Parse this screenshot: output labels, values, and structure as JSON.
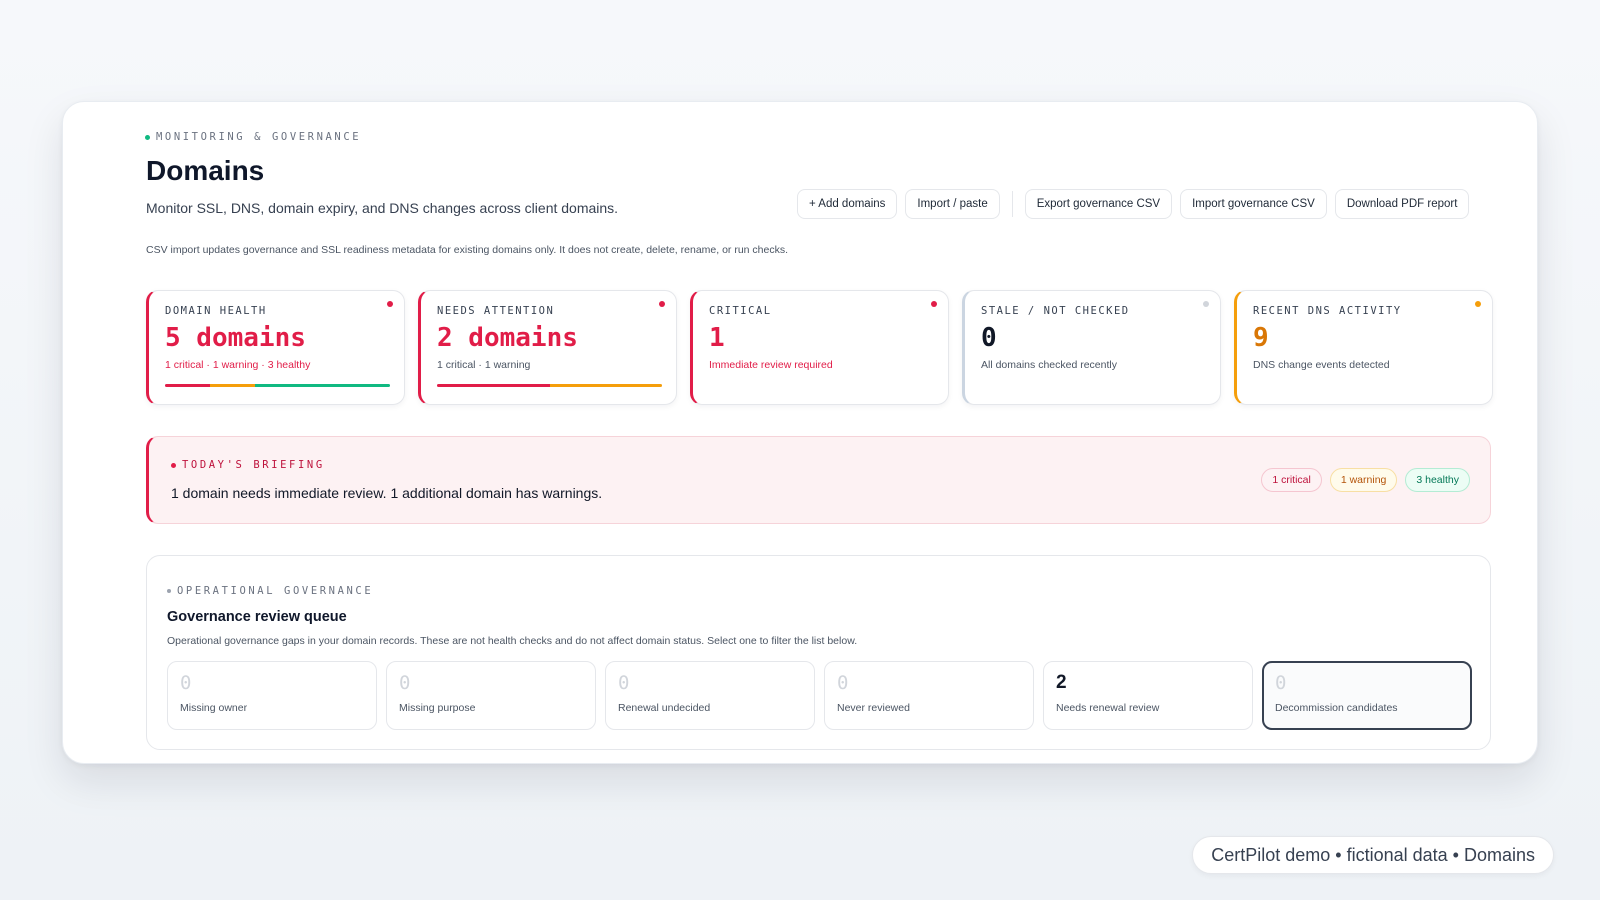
{
  "header": {
    "eyebrow": "MONITORING & GOVERNANCE",
    "title": "Domains",
    "subtitle": "Monitor SSL, DNS, domain expiry, and DNS changes across client domains.",
    "note": "CSV import updates governance and SSL readiness metadata for existing domains only. It does not create, delete, rename, or run checks."
  },
  "toolbar": {
    "add": "+ Add domains",
    "import_paste": "Import / paste",
    "export_csv": "Export governance CSV",
    "import_csv": "Import governance CSV",
    "download_pdf": "Download PDF report"
  },
  "stats": [
    {
      "label": "DOMAIN HEALTH",
      "value": "5 domains",
      "sub": "1 critical · 1 warning · 3 healthy"
    },
    {
      "label": "NEEDS ATTENTION",
      "value": "2 domains",
      "sub": "1 critical · 1 warning"
    },
    {
      "label": "CRITICAL",
      "value": "1",
      "sub": "Immediate review required"
    },
    {
      "label": "STALE / NOT CHECKED",
      "value": "0",
      "sub": "All domains checked recently"
    },
    {
      "label": "RECENT DNS ACTIVITY",
      "value": "9",
      "sub": "DNS change events detected"
    }
  ],
  "briefing": {
    "eyebrow": "TODAY'S BRIEFING",
    "text": "1 domain needs immediate review. 1 additional domain has warnings.",
    "chips": {
      "critical": "1 critical",
      "warning": "1 warning",
      "healthy": "3 healthy"
    }
  },
  "governance": {
    "eyebrow": "OPERATIONAL GOVERNANCE",
    "title": "Governance review queue",
    "description": "Operational governance gaps in your domain records. These are not health checks and do not affect domain status. Select one to filter the list below.",
    "items": [
      {
        "value": "0",
        "label": "Missing owner"
      },
      {
        "value": "0",
        "label": "Missing purpose"
      },
      {
        "value": "0",
        "label": "Renewal undecided"
      },
      {
        "value": "0",
        "label": "Never reviewed"
      },
      {
        "value": "2",
        "label": "Needs renewal review"
      },
      {
        "value": "0",
        "label": "Decommission candidates"
      }
    ]
  },
  "footer": "CertPilot demo • fictional data • Domains",
  "colors": {
    "critical": "#e11d48",
    "warning": "#f59e0b",
    "healthy": "#10b981",
    "stale": "#cbd5e1"
  }
}
